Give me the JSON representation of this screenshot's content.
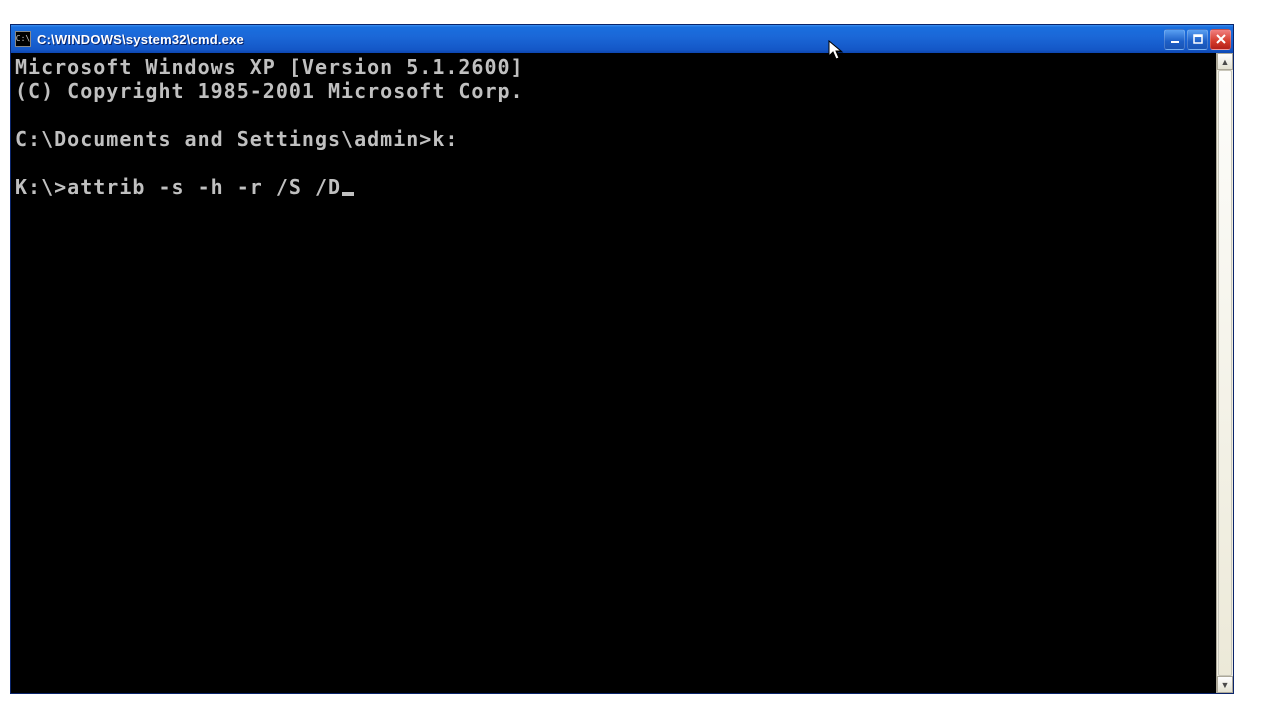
{
  "window": {
    "title": "C:\\WINDOWS\\system32\\cmd.exe",
    "app_icon_text": "C:\\"
  },
  "terminal": {
    "lines": [
      "Microsoft Windows XP [Version 5.1.2600]",
      "(C) Copyright 1985-2001 Microsoft Corp.",
      "",
      "C:\\Documents and Settings\\admin>k:",
      "",
      "K:\\>attrib -s -h -r /S /D"
    ],
    "cursor_on_last_line": true
  }
}
